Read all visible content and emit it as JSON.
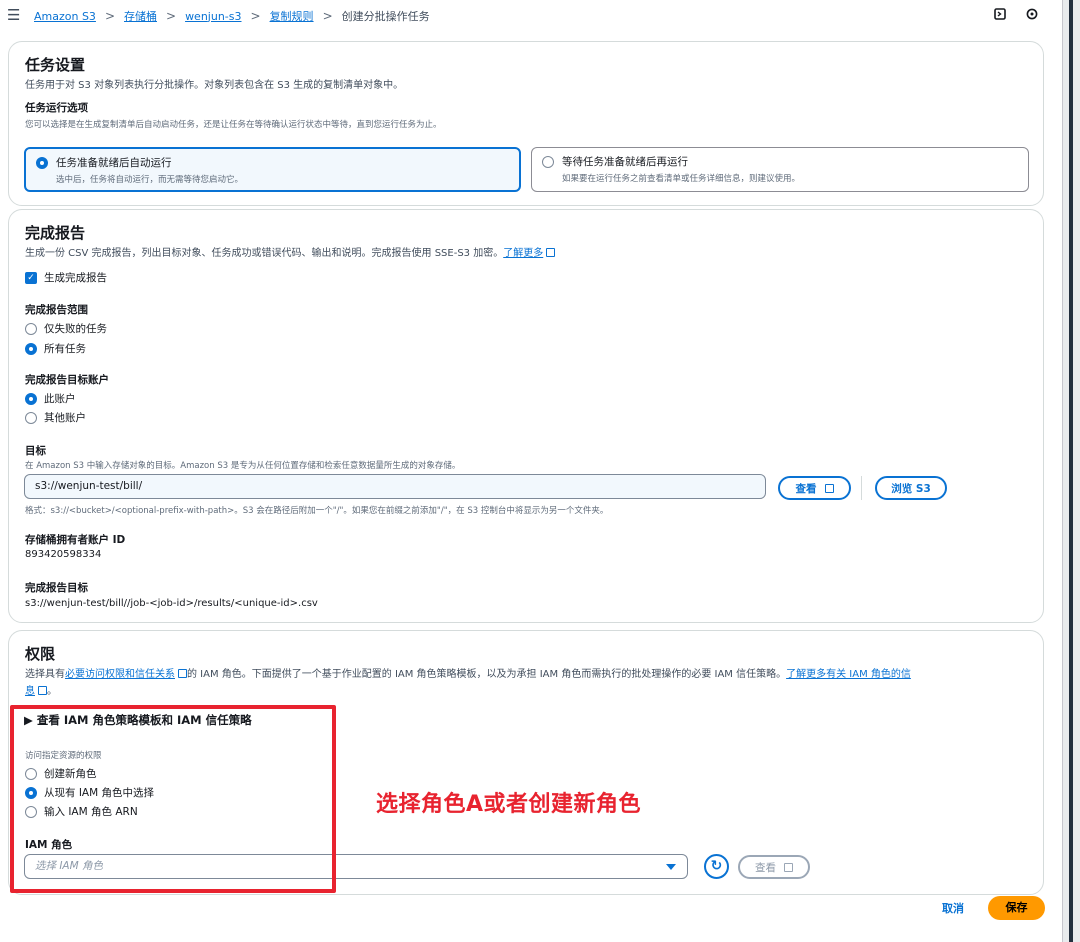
{
  "breadcrumb": {
    "items": [
      "Amazon S3",
      "存储桶",
      "wenjun-s3",
      "复制规则"
    ],
    "current": "创建分批操作任务",
    "separator": ">"
  },
  "top_icons": [
    "panel-icon",
    "settings-icon"
  ],
  "job_settings": {
    "title": "任务设置",
    "description": "任务用于对 S3 对象列表执行分批操作。对象列表包含在 S3 生成的复制清单对象中。",
    "run_option_label": "任务运行选项",
    "run_option_hint": "您可以选择是在生成复制清单后自动启动任务，还是让任务在等待确认运行状态中等待，直到您运行任务为止。",
    "options": [
      {
        "title": "任务准备就绪后自动运行",
        "desc": "选中后，任务将自动运行，而无需等待您启动它。",
        "selected": true
      },
      {
        "title": "等待任务准备就绪后再运行",
        "desc": "如果要在运行任务之前查看清单或任务详细信息，则建议使用。",
        "selected": false
      }
    ]
  },
  "completion_report": {
    "title": "完成报告",
    "description": "生成一份 CSV 完成报告，列出目标对象、任务成功或错误代码、输出和说明。完成报告使用 SSE-S3 加密。",
    "learn_more": "了解更多",
    "generate_label": "生成完成报告",
    "generate_checked": true,
    "scope_label": "完成报告范围",
    "scope_options": [
      {
        "label": "仅失败的任务",
        "selected": false
      },
      {
        "label": "所有任务",
        "selected": true
      }
    ],
    "account_label": "完成报告目标账户",
    "account_options": [
      {
        "label": "此账户",
        "selected": true
      },
      {
        "label": "其他账户",
        "selected": false
      }
    ],
    "destination_label": "目标",
    "destination_hint": "在 Amazon S3 中输入存储对象的目标。Amazon S3 是专为从任何位置存储和检索任意数据量所生成的对象存储。",
    "destination_value": "s3://wenjun-test/bill/",
    "view_button": "查看",
    "browse_button": "浏览 S3",
    "format_hint": "格式：s3://<bucket>/<optional-prefix-with-path>。S3 会在路径后附加一个\"/\"。如果您在前缀之前添加\"/\"，在 S3 控制台中将显示为另一个文件夹。",
    "owner_label": "存储桶拥有者账户 ID",
    "owner_value": "893420598334",
    "report_dest_label": "完成报告目标",
    "report_dest_value": "s3://wenjun-test/bill//job-<job-id>/results/<unique-id>.csv"
  },
  "permissions": {
    "title": "权限",
    "desc_prefix": "选择具有",
    "desc_link": "必要访问权限和信任关系",
    "desc_middle": "的 IAM 角色。下面提供了一个基于作业配置的 IAM 角色策略模板，以及为承担 IAM 角色而需执行的批处理操作的必要 IAM 信任策略。",
    "desc_link2a": "了解更多有关 IAM 角色的信",
    "desc_link2b": "息",
    "expander": "查看 IAM 角色策略模板和 IAM 信任策略",
    "access_label": "访问指定资源的权限",
    "role_options": [
      {
        "label": "创建新角色",
        "selected": false
      },
      {
        "label": "从现有 IAM 角色中选择",
        "selected": true
      },
      {
        "label": "输入 IAM 角色 ARN",
        "selected": false
      }
    ],
    "iam_role_label": "IAM 角色",
    "iam_role_placeholder": "选择 IAM 角色",
    "view_button": "查看"
  },
  "annotation": "选择角色A或者创建新角色",
  "footer": {
    "cancel": "取消",
    "save": "保存"
  },
  "colors": {
    "accent": "#0972d3",
    "save": "#ff9900",
    "annotation": "#e8232f"
  }
}
